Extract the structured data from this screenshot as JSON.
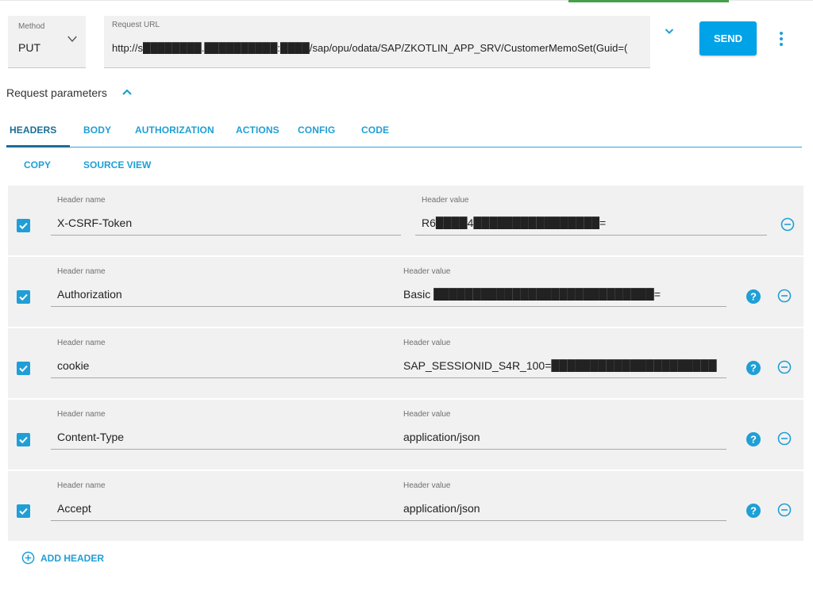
{
  "request": {
    "method_label": "Method",
    "method_value": "PUT",
    "url_label": "Request URL",
    "url_value": "http://s████████.██████████:████/sap/opu/odata/SAP/ZKOTLIN_APP_SRV/CustomerMemoSet(Guid=(",
    "send_label": "SEND"
  },
  "request_parameters": {
    "title": "Request parameters"
  },
  "tabs": [
    {
      "label": "HEADERS"
    },
    {
      "label": "BODY"
    },
    {
      "label": "AUTHORIZATION"
    },
    {
      "label": "ACTIONS"
    },
    {
      "label": "CONFIG"
    },
    {
      "label": "CODE"
    }
  ],
  "actions": {
    "copy_label": "COPY",
    "source_view_label": "SOURCE VIEW"
  },
  "headers": [
    {
      "name_label": "Header name",
      "name": "X-CSRF-Token",
      "value_label": "Header value",
      "value": "R6████4████████████████=",
      "checked": true,
      "help_icon": false
    },
    {
      "name_label": "Header name",
      "name": "Authorization",
      "value_label": "Header value",
      "value": "Basic ████████████████████████████=",
      "checked": true,
      "help_icon": true
    },
    {
      "name_label": "Header name",
      "name": "cookie",
      "value_label": "Header value",
      "value": "SAP_SESSIONID_S4R_100=█████████████████████",
      "checked": true,
      "help_icon": true
    },
    {
      "name_label": "Header name",
      "name": "Content-Type",
      "value_label": "Header value",
      "value": "application/json",
      "checked": true,
      "help_icon": true
    },
    {
      "name_label": "Header name",
      "name": "Accept",
      "value_label": "Header value",
      "value": "application/json",
      "checked": true,
      "help_icon": true
    }
  ],
  "add_header_label": "ADD HEADER",
  "colors": {
    "accent": "#1f9fd6",
    "send_button": "#00a2e8",
    "active_tab": "#1a6e96",
    "top_indicator": "#43a047",
    "field_background": "#f1f1f1"
  },
  "icons": [
    "chevron-down-icon",
    "expand-more-icon",
    "more-vert-icon",
    "chevron-up-icon",
    "checkbox-checked-icon",
    "help-icon",
    "remove-circle-icon",
    "add-circle-icon"
  ]
}
